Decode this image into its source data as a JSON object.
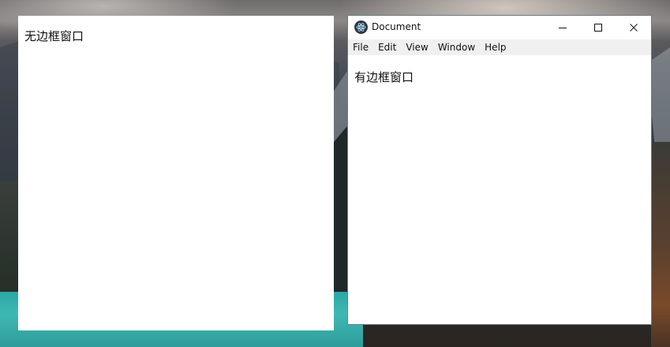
{
  "frameless_window": {
    "text": "无边框窗口"
  },
  "framed_window": {
    "title": "Document",
    "icon": "electron-atom-icon",
    "caption_buttons": {
      "minimize": "minimize-icon",
      "maximize": "maximize-icon",
      "close": "close-icon"
    },
    "menu": [
      "File",
      "Edit",
      "View",
      "Window",
      "Help"
    ],
    "content_text": "有边框窗口"
  },
  "desktop": {
    "wallpaper": "mountain-lake"
  }
}
